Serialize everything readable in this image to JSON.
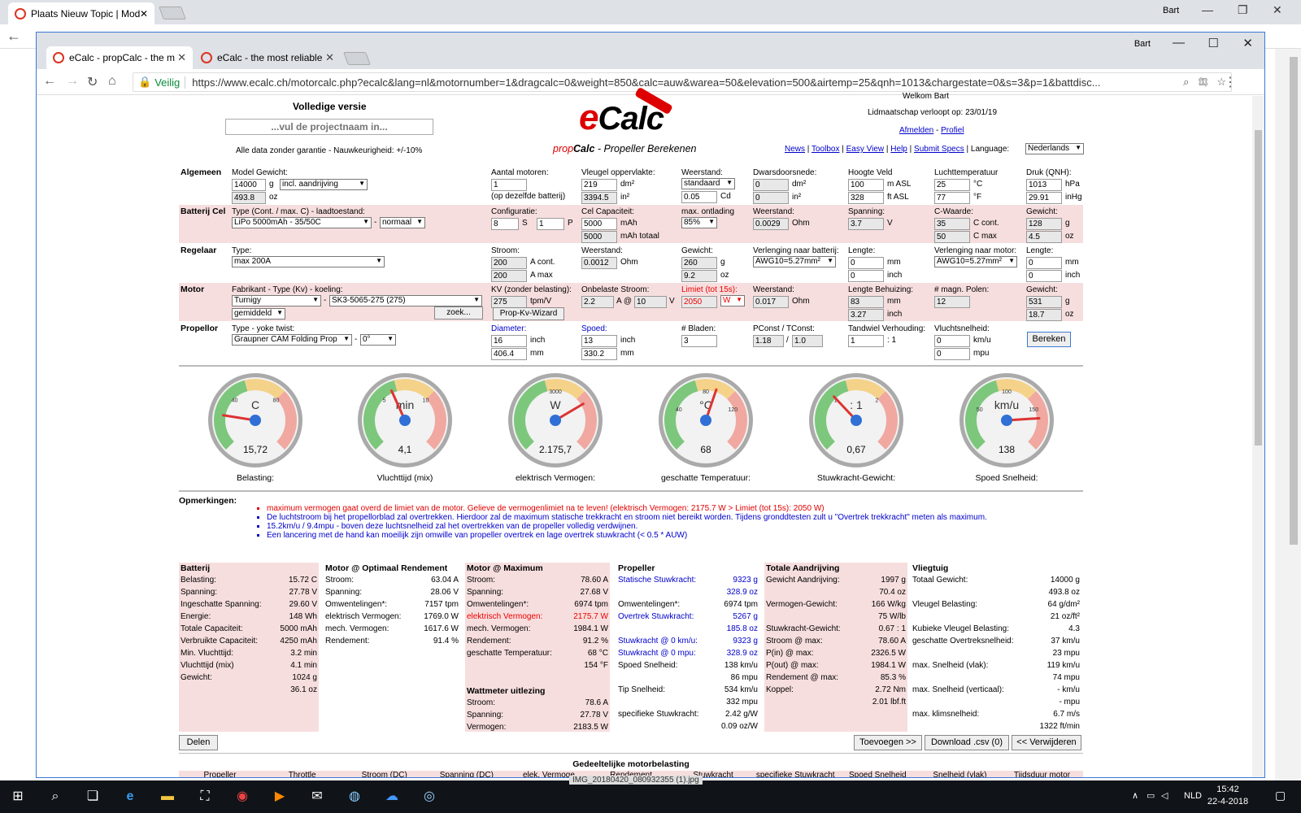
{
  "outer": {
    "tab_title": "Plaats Nieuw Topic | Mod",
    "user": "Bart"
  },
  "inner": {
    "tabs": [
      {
        "title": "eCalc - propCalc - the m"
      },
      {
        "title": "eCalc - the most reliable"
      }
    ],
    "user": "Bart",
    "secure_label": "Veilig",
    "url": "https://www.ecalc.ch/motorcalc.php?ecalc&lang=nl&motornumber=1&dragcalc=0&weight=850&calc=auw&warea=50&elevation=500&airtemp=25&qnh=1013&chargestate=0&s=3&p=1&battdisc..."
  },
  "header": {
    "version": "Volledige versie",
    "project_placeholder": "...vul de projectnaam in...",
    "disclaimer": "Alle data zonder garantie - Nauwkeurigheid: +/-10%",
    "logo_text": "eCalc",
    "subtitle_prefix": "prop",
    "subtitle_bold": "Calc",
    "subtitle_rest": " - Propeller Berekenen",
    "welcome": "Welkom Bart",
    "membership": "Lidmaatschap verloopt op: 23/01/19",
    "logout": "Afmelden",
    "profile": "Profiel",
    "nav": [
      "News",
      "Toolbox",
      "Easy View",
      "Help",
      "Submit Specs"
    ],
    "language_label": "Language:",
    "language": "Nederlands"
  },
  "algemeen": {
    "title": "Algemeen",
    "model_label": "Model Gewicht:",
    "weight": "14000",
    "g": "g",
    "incl": "incl. aandrijving",
    "weight_oz": "493.8",
    "oz": "oz",
    "motors_label": "Aantal motoren:",
    "motors": "1",
    "motors_note": "(op dezelfde batterij)",
    "wing_label": "Vleugel oppervlakte:",
    "wing": "219",
    "dm2": "dm²",
    "wing_in": "3394.5",
    "in2": "in²",
    "drag_label": "Weerstand:",
    "drag_sel": "standaard",
    "cd": "0.05",
    "cd_unit": "Cd",
    "cross_label": "Dwarsdoorsnede:",
    "cross": "0",
    "cross_in": "0",
    "alt_label": "Hoogte Veld",
    "alt": "100",
    "alt_unit": "m ASL",
    "alt_ft": "328",
    "alt_ft_unit": "ft ASL",
    "temp_label": "Luchttemperatuur",
    "temp": "25",
    "temp_c": "°C",
    "temp_f": "77",
    "temp_f_unit": "°F",
    "qnh_label": "Druk (QNH):",
    "qnh": "1013",
    "hpa": "hPa",
    "qnh_in": "29.91",
    "inhg": "inHg"
  },
  "batterij": {
    "title": "Batterij Cel",
    "type_label": "Type (Cont. / max. C) - laadtoestand:",
    "type": "LiPo 5000mAh - 35/50C",
    "state": "normaal",
    "config_label": "Configuratie:",
    "s": "8",
    "s_unit": "S",
    "p": "1",
    "p_unit": "P",
    "cap_label": "Cel Capaciteit:",
    "cap": "5000",
    "mah": "mAh",
    "cap_total": "5000",
    "mah_total": "mAh totaal",
    "disch_label": "max. ontlading",
    "disch": "85%",
    "res_label": "Weerstand:",
    "res": "0.0029",
    "ohm": "Ohm",
    "volt_label": "Spanning:",
    "volt": "3.7",
    "v": "V",
    "c_label": "C-Waarde:",
    "c_cont": "35",
    "c_cont_unit": "C cont.",
    "c_max": "50",
    "c_max_unit": "C max",
    "w_label": "Gewicht:",
    "w": "128",
    "w_oz": "4.5"
  },
  "regelaar": {
    "title": "Regelaar",
    "type_label": "Type:",
    "type": "max 200A",
    "cur_label": "Stroom:",
    "cur": "200",
    "cur_unit": "A cont.",
    "max": "200",
    "max_unit": "A max",
    "res_label": "Weerstand:",
    "res": "0.0012",
    "ohm": "Ohm",
    "w_label": "Gewicht:",
    "w": "260",
    "w_oz": "9.2",
    "ext_batt_label": "Verlenging naar batterij:",
    "ext_batt": "AWG10=5.27mm²",
    "len_label": "Lengte:",
    "len": "0",
    "mm": "mm",
    "len_in": "0",
    "inch": "inch",
    "ext_mot_label": "Verlenging naar motor:",
    "ext_mot": "AWG10=5.27mm²",
    "len2": "0",
    "len2_in": "0"
  },
  "motor": {
    "title": "Motor",
    "type_label": "Fabrikant - Type (Kv) - koeling:",
    "maker": "Turnigy",
    "model": "SK3-5065-275 (275)",
    "cooling": "gemiddeld",
    "search": "zoek...",
    "kv_label": "KV (zonder belasting):",
    "kv": "275",
    "kv_unit": "tpm/V",
    "wizard": "Prop-Kv-Wizard",
    "noload_label": "Onbelaste Stroom:",
    "noload": "2.2",
    "at": "A @",
    "noload_v": "10",
    "v": "V",
    "limit_label": "Limiet (tot 15s):",
    "limit": "2050",
    "limit_unit": "W",
    "res_label": "Weerstand:",
    "res": "0.017",
    "ohm": "Ohm",
    "case_label": "Lengte Behuizing:",
    "case": "83",
    "case_in": "3.27",
    "poles_label": "# magn. Polen:",
    "poles": "12",
    "w_label": "Gewicht:",
    "w": "531",
    "w_oz": "18.7"
  },
  "propeller": {
    "title": "Propellor",
    "type_label": "Type - yoke twist:",
    "type": "Graupner CAM Folding Prop",
    "twist": "0°",
    "dia_label": "Diameter:",
    "dia": "16",
    "dia_mm": "406.4",
    "pitch_label": "Spoed:",
    "pitch": "13",
    "pitch_mm": "330.2",
    "blades_label": "# Bladen:",
    "blades": "3",
    "pconst_label": "PConst / TConst:",
    "pconst": "1.18",
    "tconst": "1.0",
    "gear_label": "Tandwiel Verhouding:",
    "gear": "1",
    "gear_unit": ": 1",
    "speed_label": "Vluchtsnelheid:",
    "speed": "0",
    "kmh": "km/u",
    "speed_mph": "0",
    "mph": "mpu",
    "calc": "Bereken"
  },
  "gauges": [
    {
      "unit": "C",
      "value": "15,72",
      "caption": "Belasting:",
      "ticks": [
        "40",
        "80"
      ],
      "needle": 0.2
    },
    {
      "unit": "min",
      "value": "4,1",
      "caption": "Vluchttijd (mix)",
      "ticks": [
        "5",
        "10"
      ],
      "needle": 0.41
    },
    {
      "unit": "W",
      "value": "2.175,7",
      "caption": "elektrisch Vermogen:",
      "ticks": [
        "3000"
      ],
      "needle": 0.72
    },
    {
      "unit": "°C",
      "value": "68",
      "caption": "geschatte Temperatuur:",
      "ticks": [
        "40",
        "80",
        "120"
      ],
      "needle": 0.57
    },
    {
      "unit": ": 1",
      "value": "0,67",
      "caption": "Stuwkracht-Gewicht:",
      "ticks": [
        "1",
        "2"
      ],
      "needle": 0.34
    },
    {
      "unit": "km/u",
      "value": "138",
      "caption": "Spoed Snelheid:",
      "ticks": [
        "50",
        "100",
        "150"
      ],
      "needle": 0.82
    }
  ],
  "remarks": {
    "title": "Opmerkingen:",
    "items": [
      {
        "text": "maximum vermogen gaat overd de limiet van de motor. Gelieve de vermogenlimiet na te leven! (elektrisch Vermogen: 2175.7 W > Limiet (tot 15s): 2050 W)",
        "color": "#e00000"
      },
      {
        "text": "De luchtstroom bij het propellorblad zal overtrekken. Hierdoor zal de maximum statische trekkracht en stroom niet bereikt worden. Tijdens gronddtesten zult u \"Overtrek trekkracht\" meten als maximum.",
        "color": "#0000cc"
      },
      {
        "text": "15.2km/u / 9.4mpu - boven deze luchtsnelheid zal het overtrekken van de propeller volledig verdwijnen.",
        "color": "#0000cc"
      },
      {
        "text": "Een lancering met de hand kan moeilijk zijn omwille van propeller overtrek en lage overtrek stuwkracht (< 0.5 * AUW)",
        "color": "#0000cc"
      }
    ]
  },
  "results": {
    "batterij": {
      "title": "Batterij",
      "rows": [
        [
          "Belasting:",
          "15.72 C"
        ],
        [
          "Spanning:",
          "27.78 V"
        ],
        [
          "Ingeschatte Spanning:",
          "29.60 V"
        ],
        [
          "Energie:",
          "148 Wh"
        ],
        [
          "Totale Capaciteit:",
          "5000 mAh"
        ],
        [
          "Verbruikte Capaciteit:",
          "4250 mAh"
        ],
        [
          "Min. Vluchttijd:",
          "3.2 min"
        ],
        [
          "Vluchttijd (mix)",
          "4.1 min"
        ],
        [
          "Gewicht:",
          "1024 g"
        ],
        [
          "",
          "36.1 oz"
        ]
      ]
    },
    "optimaal": {
      "title": "Motor @ Optimaal Rendement",
      "rows": [
        [
          "Stroom:",
          "63.04 A"
        ],
        [
          "Spanning:",
          "28.06 V"
        ],
        [
          "Omwentelingen*:",
          "7157 tpm"
        ],
        [
          "elektrisch Vermogen:",
          "1769.0 W"
        ],
        [
          "mech. Vermogen:",
          "1617.6 W"
        ],
        [
          "Rendement:",
          "91.4 %"
        ]
      ]
    },
    "maximum": {
      "title": "Motor @ Maximum",
      "rows": [
        [
          "Stroom:",
          "78.60 A"
        ],
        [
          "Spanning:",
          "27.68 V"
        ],
        [
          "Omwentelingen*:",
          "6974 tpm"
        ],
        [
          "elektrisch Vermogen:",
          "2175.7 W"
        ],
        [
          "mech. Vermogen:",
          "1984.1 W"
        ],
        [
          "Rendement:",
          "91.2 %"
        ],
        [
          "geschatte Temperatuur:",
          "68 °C"
        ],
        [
          "",
          "154 °F"
        ]
      ],
      "watt_title": "Wattmeter uitlezing",
      "watt_rows": [
        [
          "Stroom:",
          "78.6 A"
        ],
        [
          "Spanning:",
          "27.78 V"
        ],
        [
          "Vermogen:",
          "2183.5 W"
        ]
      ]
    },
    "propeller": {
      "title": "Propeller",
      "rows": [
        [
          "Statische Stuwkracht:",
          "9323 g"
        ],
        [
          "",
          "328.9 oz"
        ],
        [
          "Omwentelingen*:",
          "6974 tpm"
        ],
        [
          "Overtrek Stuwkracht:",
          "5267 g"
        ],
        [
          "",
          "185.8 oz"
        ],
        [
          "Stuwkracht @ 0 km/u:",
          "9323 g"
        ],
        [
          "Stuwkracht @ 0 mpu:",
          "328.9 oz"
        ],
        [
          "Spoed Snelheid:",
          "138 km/u"
        ],
        [
          "",
          "86 mpu"
        ],
        [
          "Tip Snelheid:",
          "534 km/u"
        ],
        [
          "",
          "332 mpu"
        ],
        [
          "specifieke Stuwkracht:",
          "2.42 g/W"
        ],
        [
          "",
          "0.09 oz/W"
        ]
      ]
    },
    "totaal": {
      "title": "Totale Aandrijving",
      "rows": [
        [
          "Gewicht Aandrijving:",
          "1997 g"
        ],
        [
          "",
          "70.4 oz"
        ],
        [
          "Vermogen-Gewicht:",
          "166 W/kg"
        ],
        [
          "",
          "75 W/lb"
        ],
        [
          "Stuwkracht-Gewicht:",
          "0.67 : 1"
        ],
        [
          "Stroom @ max:",
          "78.60 A"
        ],
        [
          "P(in) @ max:",
          "2326.5 W"
        ],
        [
          "P(out) @ max:",
          "1984.1 W"
        ],
        [
          "Rendement @ max:",
          "85.3 %"
        ],
        [
          "Koppel:",
          "2.72 Nm"
        ],
        [
          "",
          "2.01 lbf.ft"
        ]
      ]
    },
    "vliegtuig": {
      "title": "Vliegtuig",
      "rows": [
        [
          "Totaal Gewicht:",
          "14000 g"
        ],
        [
          "",
          "493.8 oz"
        ],
        [
          "Vleugel Belasting:",
          "64 g/dm²"
        ],
        [
          "",
          "21 oz/ft²"
        ],
        [
          "Kubieke Vleugel Belasting:",
          "4.3"
        ],
        [
          "geschatte Overtreksnelheid:",
          "37 km/u"
        ],
        [
          "",
          "23 mpu"
        ],
        [
          "max. Snelheid (vlak):",
          "119 km/u"
        ],
        [
          "",
          "74 mpu"
        ],
        [
          "max. Snelheid (verticaal):",
          "- km/u"
        ],
        [
          "",
          "- mpu"
        ],
        [
          "max. klimsnelheid:",
          "6.7 m/s"
        ],
        [
          "",
          "1322 ft/min"
        ]
      ]
    }
  },
  "actions": {
    "share": "Delen",
    "add": "Toevoegen >>",
    "download": "Download .csv (0)",
    "remove": "<< Verwijderen"
  },
  "partial": {
    "title": "Gedeeltelijke motorbelasting",
    "columns": [
      "Propeller",
      "Throttle",
      "Stroom (DC)",
      "Spanning (DC)",
      "elek. Vermoge",
      "Rendement",
      "Stuwkracht",
      "specifieke Stuwkracht",
      "Spoed Snelheid",
      "Snelheid (vlak)",
      "Tijdsduur motor"
    ]
  },
  "taskbar": {
    "lang": "NLD",
    "time": "15:42",
    "date": "22-4-2018",
    "file_hint": "IMG_20180420_080932355 (1).jpg"
  }
}
